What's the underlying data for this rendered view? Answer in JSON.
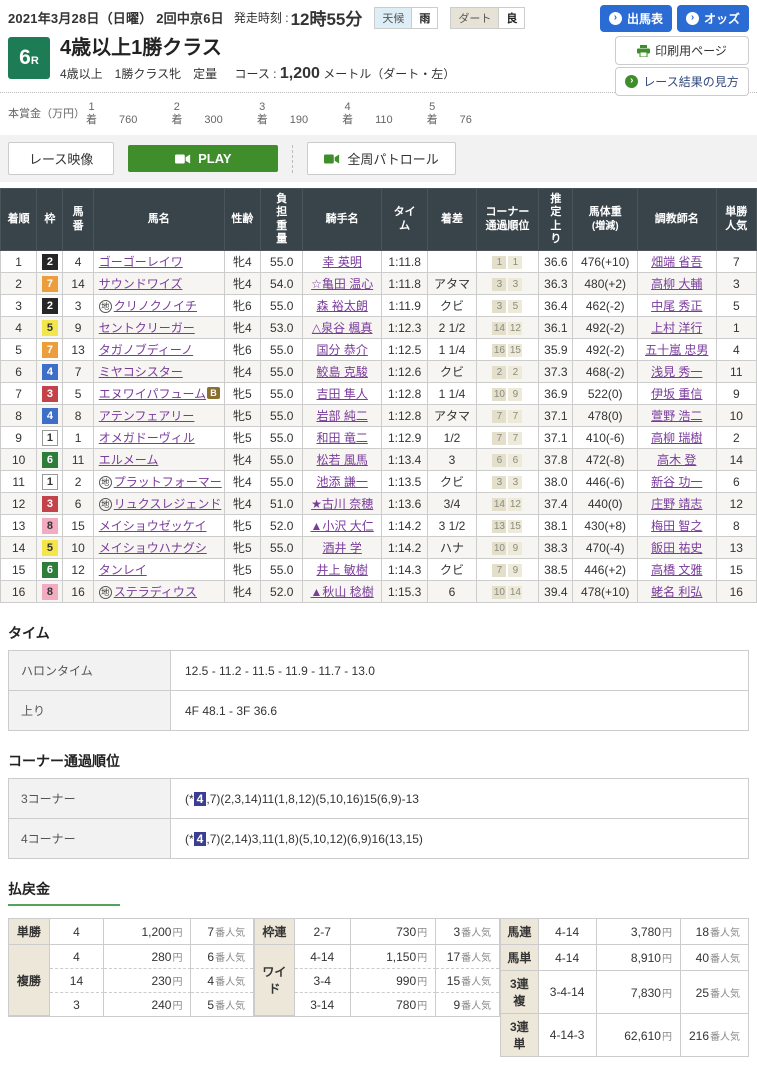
{
  "header": {
    "date": "2021年3月28日（日曜）  2回中京6日",
    "start_label": "発走時刻 :",
    "start_time": "12時55分",
    "weather": {
      "label": "天候",
      "value": "雨"
    },
    "track": {
      "label": "ダート",
      "value": "良"
    },
    "buttons": {
      "entries": "出馬表",
      "odds": "オッズ",
      "print": "印刷用ページ",
      "guide": "レース結果の見方"
    }
  },
  "race": {
    "number": "6",
    "number_suffix": "R",
    "title": "4歳以上1勝クラス",
    "conditions": "4歳以上　1勝クラス牝　定量",
    "course_label": "コース :",
    "course_value": "1,200",
    "course_unit": "メートル（ダート・左）"
  },
  "prize": {
    "label": "本賞金（万円）",
    "rank_suffix": "着",
    "items": [
      {
        "rank": "1",
        "value": "760"
      },
      {
        "rank": "2",
        "value": "300"
      },
      {
        "rank": "3",
        "value": "190"
      },
      {
        "rank": "4",
        "value": "110"
      },
      {
        "rank": "5",
        "value": "76"
      }
    ]
  },
  "video": {
    "race_video": "レース映像",
    "play": "PLAY",
    "patrol": "全周パトロール"
  },
  "results": {
    "columns": [
      "着順",
      "枠",
      "馬番",
      "馬名",
      "性齢",
      "負担重量",
      "騎手名",
      "タイム",
      "着差",
      "コーナー通過順位",
      "推定上り",
      "馬体重",
      "調教師名",
      "単勝人気"
    ],
    "bw_sub": "(増減)",
    "horses": [
      {
        "pos": 1,
        "waku": 2,
        "num": 4,
        "mark": "",
        "blinker": "",
        "name": "ゴーゴーレイワ",
        "sex_age": "牝4",
        "weight": "55.0",
        "jockey": "幸 英明",
        "time": "1:11.8",
        "margin": "",
        "corners": [
          "1",
          "1"
        ],
        "agari": "36.6",
        "body_weight": "476(+10)",
        "trainer": "畑端 省吾",
        "fav": 7
      },
      {
        "pos": 2,
        "waku": 7,
        "num": 14,
        "mark": "",
        "blinker": "",
        "name": "サウンドワイズ",
        "sex_age": "牝4",
        "weight": "54.0",
        "jockey": "☆亀田 温心",
        "time": "1:11.8",
        "margin": "アタマ",
        "corners": [
          "3",
          "3"
        ],
        "agari": "36.3",
        "body_weight": "480(+2)",
        "trainer": "高柳 大輔",
        "fav": 3
      },
      {
        "pos": 3,
        "waku": 2,
        "num": 3,
        "mark": "地",
        "blinker": "",
        "name": "クリノクノイチ",
        "sex_age": "牝6",
        "weight": "55.0",
        "jockey": "森 裕太朗",
        "time": "1:11.9",
        "margin": "クビ",
        "corners": [
          "3",
          "5"
        ],
        "agari": "36.4",
        "body_weight": "462(-2)",
        "trainer": "中尾 秀正",
        "fav": 5
      },
      {
        "pos": 4,
        "waku": 5,
        "num": 9,
        "mark": "",
        "blinker": "",
        "name": "セントクリーガー",
        "sex_age": "牝4",
        "weight": "53.0",
        "jockey": "△泉谷 楓真",
        "time": "1:12.3",
        "margin": "2 1/2",
        "corners": [
          "14",
          "12"
        ],
        "agari": "36.1",
        "body_weight": "492(-2)",
        "trainer": "上村 洋行",
        "fav": 1
      },
      {
        "pos": 5,
        "waku": 7,
        "num": 13,
        "mark": "",
        "blinker": "",
        "name": "タガノブディーノ",
        "sex_age": "牝6",
        "weight": "55.0",
        "jockey": "国分 恭介",
        "time": "1:12.5",
        "margin": "1 1/4",
        "corners": [
          "16",
          "15"
        ],
        "agari": "35.9",
        "body_weight": "492(-2)",
        "trainer": "五十嵐 忠男",
        "fav": 4
      },
      {
        "pos": 6,
        "waku": 4,
        "num": 7,
        "mark": "",
        "blinker": "",
        "name": "ミヤコシスター",
        "sex_age": "牝4",
        "weight": "55.0",
        "jockey": "鮫島 克駿",
        "time": "1:12.6",
        "margin": "クビ",
        "corners": [
          "2",
          "2"
        ],
        "agari": "37.3",
        "body_weight": "468(-2)",
        "trainer": "浅見 秀一",
        "fav": 11
      },
      {
        "pos": 7,
        "waku": 3,
        "num": 5,
        "mark": "",
        "blinker": "B",
        "name": "エヌワイパフューム",
        "sex_age": "牝5",
        "weight": "55.0",
        "jockey": "吉田 隼人",
        "time": "1:12.8",
        "margin": "1 1/4",
        "corners": [
          "10",
          "9"
        ],
        "agari": "36.9",
        "body_weight": "522(0)",
        "trainer": "伊坂 重信",
        "fav": 9
      },
      {
        "pos": 8,
        "waku": 4,
        "num": 8,
        "mark": "",
        "blinker": "",
        "name": "アテンフェアリー",
        "sex_age": "牝5",
        "weight": "55.0",
        "jockey": "岩部 純二",
        "time": "1:12.8",
        "margin": "アタマ",
        "corners": [
          "7",
          "7"
        ],
        "agari": "37.1",
        "body_weight": "478(0)",
        "trainer": "萱野 浩二",
        "fav": 10
      },
      {
        "pos": 9,
        "waku": 1,
        "num": 1,
        "mark": "",
        "blinker": "",
        "name": "オメガドーヴィル",
        "sex_age": "牝5",
        "weight": "55.0",
        "jockey": "和田 竜二",
        "time": "1:12.9",
        "margin": "1/2",
        "corners": [
          "7",
          "7"
        ],
        "agari": "37.1",
        "body_weight": "410(-6)",
        "trainer": "高柳 瑞樹",
        "fav": 2
      },
      {
        "pos": 10,
        "waku": 6,
        "num": 11,
        "mark": "",
        "blinker": "",
        "name": "エルメーム",
        "sex_age": "牝4",
        "weight": "55.0",
        "jockey": "松若 風馬",
        "time": "1:13.4",
        "margin": "3",
        "corners": [
          "6",
          "6"
        ],
        "agari": "37.8",
        "body_weight": "472(-8)",
        "trainer": "高木 登",
        "fav": 14
      },
      {
        "pos": 11,
        "waku": 1,
        "num": 2,
        "mark": "地",
        "blinker": "",
        "name": "プラットフォーマー",
        "sex_age": "牝4",
        "weight": "55.0",
        "jockey": "池添 謙一",
        "time": "1:13.5",
        "margin": "クビ",
        "corners": [
          "3",
          "3"
        ],
        "agari": "38.0",
        "body_weight": "446(-6)",
        "trainer": "新谷 功一",
        "fav": 6
      },
      {
        "pos": 12,
        "waku": 3,
        "num": 6,
        "mark": "地",
        "blinker": "",
        "name": "リュクスレジェンド",
        "sex_age": "牝4",
        "weight": "51.0",
        "jockey": "★古川 奈穂",
        "time": "1:13.6",
        "margin": "3/4",
        "corners": [
          "14",
          "12"
        ],
        "agari": "37.4",
        "body_weight": "440(0)",
        "trainer": "庄野 靖志",
        "fav": 12
      },
      {
        "pos": 13,
        "waku": 8,
        "num": 15,
        "mark": "",
        "blinker": "",
        "name": "メイショウゼッケイ",
        "sex_age": "牝5",
        "weight": "52.0",
        "jockey": "▲小沢 大仁",
        "time": "1:14.2",
        "margin": "3 1/2",
        "corners": [
          "13",
          "15"
        ],
        "agari": "38.1",
        "body_weight": "430(+8)",
        "trainer": "梅田 智之",
        "fav": 8
      },
      {
        "pos": 14,
        "waku": 5,
        "num": 10,
        "mark": "",
        "blinker": "",
        "name": "メイショウハナグシ",
        "sex_age": "牝5",
        "weight": "55.0",
        "jockey": "酒井 学",
        "time": "1:14.2",
        "margin": "ハナ",
        "corners": [
          "10",
          "9"
        ],
        "agari": "38.3",
        "body_weight": "470(-4)",
        "trainer": "飯田 祐史",
        "fav": 13
      },
      {
        "pos": 15,
        "waku": 6,
        "num": 12,
        "mark": "",
        "blinker": "",
        "name": "タンレイ",
        "sex_age": "牝5",
        "weight": "55.0",
        "jockey": "井上 敏樹",
        "time": "1:14.3",
        "margin": "クビ",
        "corners": [
          "7",
          "9"
        ],
        "agari": "38.5",
        "body_weight": "446(+2)",
        "trainer": "高橋 文雅",
        "fav": 15
      },
      {
        "pos": 16,
        "waku": 8,
        "num": 16,
        "mark": "地",
        "blinker": "",
        "name": "ステラディウス",
        "sex_age": "牝4",
        "weight": "52.0",
        "jockey": "▲秋山 稔樹",
        "time": "1:15.3",
        "margin": "6",
        "corners": [
          "10",
          "14"
        ],
        "agari": "39.4",
        "body_weight": "478(+10)",
        "trainer": "蛯名 利弘",
        "fav": 16
      }
    ]
  },
  "time_section": {
    "heading": "タイム",
    "rows": [
      {
        "label": "ハロンタイム",
        "value": "12.5 - 11.2 - 11.5 - 11.9 - 11.7 - 13.0"
      },
      {
        "label": "上り",
        "value": "4F 48.1 - 3F 36.6"
      }
    ]
  },
  "corner_section": {
    "heading": "コーナー通過順位",
    "rows": [
      {
        "label": "3コーナー",
        "pre": "(*",
        "hl": "4",
        "rest": ",7)(2,3,14)11(1,8,12)(5,10,16)15(6,9)-13"
      },
      {
        "label": "4コーナー",
        "pre": "(*",
        "hl": "4",
        "rest": ",7)(2,14)3,11(1,8)(5,10,12)(6,9)16(13,15)"
      }
    ]
  },
  "payouts": {
    "heading": "払戻金",
    "yen_suffix": "円",
    "fav_suffix": "番人気",
    "groups": [
      {
        "bets": [
          {
            "label": "単勝",
            "rows": [
              {
                "combo": "4",
                "amount": "1,200",
                "fav": "7"
              }
            ]
          },
          {
            "label": "複勝",
            "rows": [
              {
                "combo": "4",
                "amount": "280",
                "fav": "6"
              },
              {
                "combo": "14",
                "amount": "230",
                "fav": "4"
              },
              {
                "combo": "3",
                "amount": "240",
                "fav": "5"
              }
            ]
          }
        ]
      },
      {
        "bets": [
          {
            "label": "枠連",
            "rows": [
              {
                "combo": "2-7",
                "amount": "730",
                "fav": "3"
              }
            ]
          },
          {
            "label": "ワイド",
            "rows": [
              {
                "combo": "4-14",
                "amount": "1,150",
                "fav": "17"
              },
              {
                "combo": "3-4",
                "amount": "990",
                "fav": "15"
              },
              {
                "combo": "3-14",
                "amount": "780",
                "fav": "9"
              }
            ]
          }
        ]
      },
      {
        "bets": [
          {
            "label": "馬連",
            "rows": [
              {
                "combo": "4-14",
                "amount": "3,780",
                "fav": "18"
              }
            ]
          },
          {
            "label": "馬単",
            "rows": [
              {
                "combo": "4-14",
                "amount": "8,910",
                "fav": "40"
              }
            ]
          },
          {
            "label": "3連複",
            "rows": [
              {
                "combo": "3-4-14",
                "amount": "7,830",
                "fav": "25"
              }
            ]
          },
          {
            "label": "3連単",
            "rows": [
              {
                "combo": "4-14-3",
                "amount": "62,610",
                "fav": "216"
              }
            ]
          }
        ]
      }
    ]
  },
  "colors": {
    "accent_blue": "#2b6bd4",
    "accent_green": "#3f8d2b",
    "race_badge_green": "#1d7b56",
    "table_header": "#39444a",
    "link_purple": "#7a3b9d",
    "corner_highlight": "#3a3d92",
    "waku_frame_colors": [
      "#ffffff",
      "#262626",
      "#c4424a",
      "#3d6fc9",
      "#f3e64d",
      "#2f7d3b",
      "#ec9d3c",
      "#f2abc1"
    ]
  }
}
